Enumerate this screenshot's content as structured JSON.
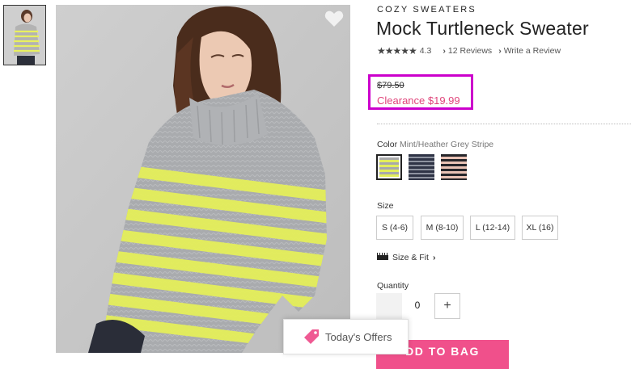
{
  "product": {
    "brand": "COZY SWEATERS",
    "title": "Mock Turtleneck Sweater",
    "stars": "★★★★★",
    "rating": "4.3",
    "reviews_link": "12 Reviews",
    "write_review_link": "Write a Review"
  },
  "price": {
    "original": "$79.50",
    "clearance": "Clearance $19.99",
    "clearance_color": "#e0457b",
    "highlight_color": "#cc00cc"
  },
  "color": {
    "label": "Color",
    "value": "Mint/Heather Grey Stripe",
    "swatches": [
      {
        "name": "Mint/Heather Grey Stripe",
        "selected": true
      },
      {
        "name": "Navy Stripe",
        "selected": false
      },
      {
        "name": "Black/Pink Stripe",
        "selected": false
      }
    ]
  },
  "size": {
    "label": "Size",
    "options": [
      "S (4-6)",
      "M (8-10)",
      "L (12-14)",
      "XL (16)"
    ],
    "fit_link": "Size & Fit"
  },
  "quantity": {
    "label": "Quantity",
    "value": "0",
    "plus": "+"
  },
  "actions": {
    "add_to_bag": "DD TO BAG"
  },
  "offers": {
    "label": "Today's Offers"
  },
  "icons": {
    "heart": "heart-icon",
    "tag": "tag-icon",
    "ruler": "ruler-icon"
  }
}
